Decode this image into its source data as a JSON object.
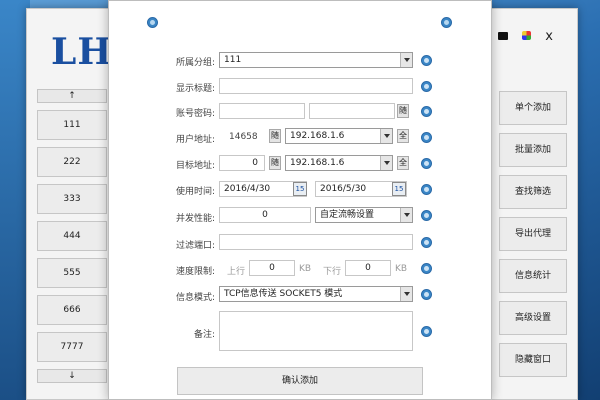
{
  "app": {
    "logo": "LH",
    "window_close": "x"
  },
  "left_list": {
    "up": "↑",
    "down": "↓",
    "items": [
      "111",
      "222",
      "333",
      "444",
      "555",
      "666",
      "7777"
    ]
  },
  "right_actions": [
    "单个添加",
    "批量添加",
    "查找筛选",
    "导出代理",
    "信息统计",
    "高级设置",
    "隐藏窗口"
  ],
  "dialog": {
    "rows": {
      "group": {
        "label": "所属分组:",
        "value": "111"
      },
      "title": {
        "label": "显示标题:",
        "value": ""
      },
      "account": {
        "label": "账号密码:",
        "user": "",
        "password": "",
        "btn": "随"
      },
      "user_addr": {
        "label": "用户地址:",
        "port": "14658",
        "btn": "随",
        "ip": "192.168.1.6",
        "all": "全"
      },
      "target_addr": {
        "label": "目标地址:",
        "port": "0",
        "btn": "随",
        "ip": "192.168.1.6",
        "all": "全"
      },
      "time": {
        "label": "使用时间:",
        "start": "2016/4/30",
        "end": "2016/5/30",
        "cal": "15"
      },
      "concurrency": {
        "label": "并发性能:",
        "value": "0",
        "mode": "自定流畅设置"
      },
      "filter_port": {
        "label": "过滤端口:",
        "value": ""
      },
      "speed": {
        "label": "速度限制:",
        "up_label": "上行",
        "up_value": "0",
        "down_label": "下行",
        "down_value": "0",
        "unit": "KB"
      },
      "info_mode": {
        "label": "信息模式:",
        "value": "TCP信息传送 SOCKET5 模式"
      },
      "note": {
        "label": "备注:",
        "value": ""
      }
    },
    "confirm": "确认添加"
  }
}
